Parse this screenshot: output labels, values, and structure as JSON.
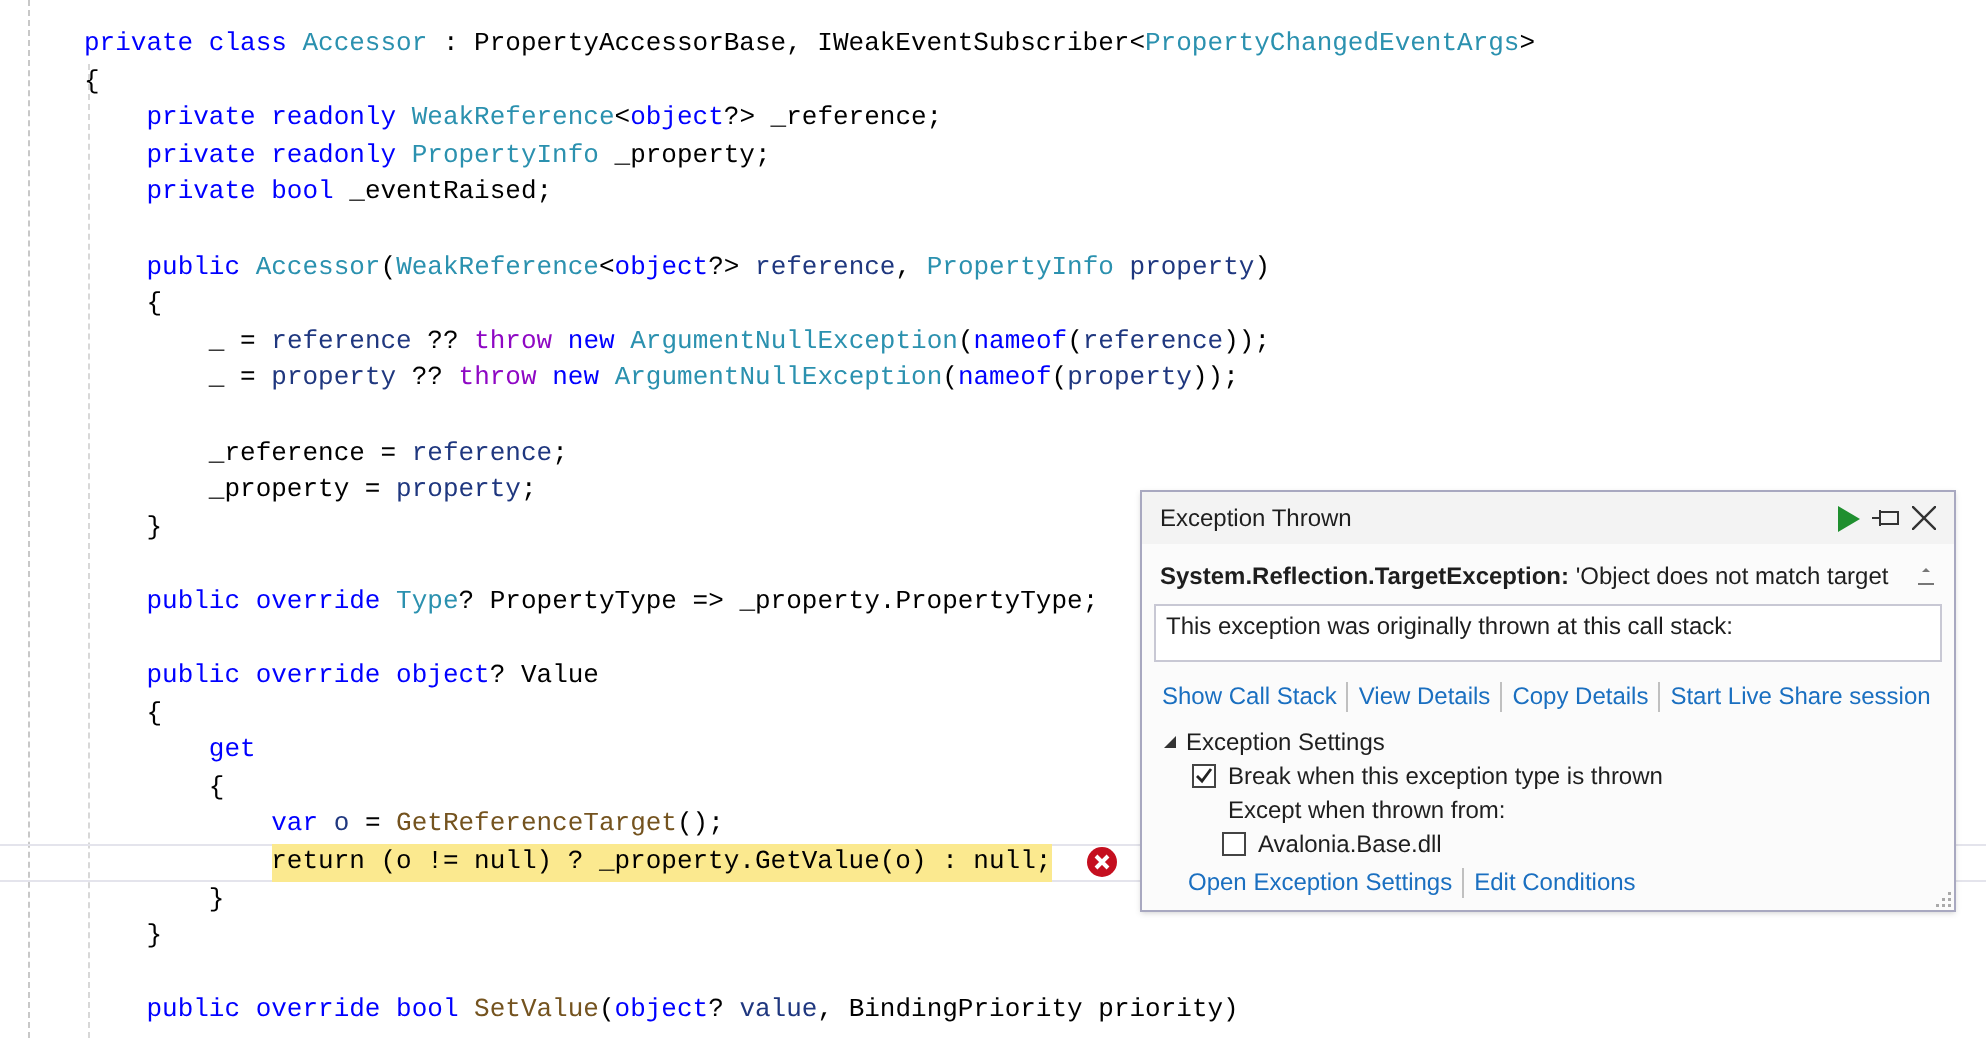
{
  "editor": {
    "lines": [
      {
        "kind": "code",
        "current": false,
        "tokens": [
          {
            "text": "private class ",
            "kind": "keyword"
          },
          {
            "text": "Accessor",
            "kind": "type"
          },
          {
            "text": " : PropertyAccessorBase, IWeakEventSubscriber<",
            "kind": "plain"
          },
          {
            "text": "PropertyChangedEventArgs",
            "kind": "type"
          },
          {
            "text": ">",
            "kind": "plain"
          }
        ]
      },
      {
        "kind": "code",
        "current": false,
        "tokens": [
          {
            "text": "{",
            "kind": "plain"
          }
        ]
      },
      {
        "kind": "code",
        "current": false,
        "tokens": [
          {
            "text": "    private readonly ",
            "kind": "keyword"
          },
          {
            "text": "WeakReference",
            "kind": "type"
          },
          {
            "text": "<",
            "kind": "plain"
          },
          {
            "text": "object",
            "kind": "keyword"
          },
          {
            "text": "?> _reference;",
            "kind": "plain"
          }
        ]
      },
      {
        "kind": "code",
        "current": false,
        "tokens": [
          {
            "text": "    private readonly ",
            "kind": "keyword"
          },
          {
            "text": "PropertyInfo",
            "kind": "type"
          },
          {
            "text": " _property;",
            "kind": "plain"
          }
        ]
      },
      {
        "kind": "code",
        "current": false,
        "tokens": [
          {
            "text": "    private bool",
            "kind": "keyword"
          },
          {
            "text": " _eventRaised;",
            "kind": "plain"
          }
        ]
      },
      {
        "kind": "blank"
      },
      {
        "kind": "code",
        "current": false,
        "tokens": [
          {
            "text": "    public ",
            "kind": "keyword"
          },
          {
            "text": "Accessor",
            "kind": "type"
          },
          {
            "text": "(",
            "kind": "plain"
          },
          {
            "text": "WeakReference",
            "kind": "type"
          },
          {
            "text": "<",
            "kind": "plain"
          },
          {
            "text": "object",
            "kind": "keyword"
          },
          {
            "text": "?> ",
            "kind": "plain"
          },
          {
            "text": "reference",
            "kind": "variable"
          },
          {
            "text": ", ",
            "kind": "plain"
          },
          {
            "text": "PropertyInfo",
            "kind": "type"
          },
          {
            "text": " property",
            "kind": "variable"
          },
          {
            "text": ")",
            "kind": "plain"
          }
        ]
      },
      {
        "kind": "code",
        "current": false,
        "tokens": [
          {
            "text": "    {",
            "kind": "plain"
          }
        ]
      },
      {
        "kind": "code",
        "current": false,
        "tokens": [
          {
            "text": "        _ = ",
            "kind": "plain"
          },
          {
            "text": "reference",
            "kind": "variable"
          },
          {
            "text": " ?? ",
            "kind": "plain"
          },
          {
            "text": "throw",
            "kind": "control"
          },
          {
            "text": " new ",
            "kind": "keyword"
          },
          {
            "text": "ArgumentNullException",
            "kind": "type"
          },
          {
            "text": "(",
            "kind": "plain"
          },
          {
            "text": "nameof",
            "kind": "keyword"
          },
          {
            "text": "(",
            "kind": "plain"
          },
          {
            "text": "reference",
            "kind": "variable"
          },
          {
            "text": "));",
            "kind": "plain"
          }
        ]
      },
      {
        "kind": "code",
        "current": false,
        "tokens": [
          {
            "text": "        _ = ",
            "kind": "plain"
          },
          {
            "text": "property",
            "kind": "variable"
          },
          {
            "text": " ?? ",
            "kind": "plain"
          },
          {
            "text": "throw",
            "kind": "control"
          },
          {
            "text": " new ",
            "kind": "keyword"
          },
          {
            "text": "ArgumentNullException",
            "kind": "type"
          },
          {
            "text": "(",
            "kind": "plain"
          },
          {
            "text": "nameof",
            "kind": "keyword"
          },
          {
            "text": "(",
            "kind": "plain"
          },
          {
            "text": "property",
            "kind": "variable"
          },
          {
            "text": "));",
            "kind": "plain"
          }
        ]
      },
      {
        "kind": "blank"
      },
      {
        "kind": "code",
        "current": false,
        "tokens": [
          {
            "text": "        _reference = ",
            "kind": "plain"
          },
          {
            "text": "reference",
            "kind": "variable"
          },
          {
            "text": ";",
            "kind": "plain"
          }
        ]
      },
      {
        "kind": "code",
        "current": false,
        "tokens": [
          {
            "text": "        _property = ",
            "kind": "plain"
          },
          {
            "text": "property",
            "kind": "variable"
          },
          {
            "text": ";",
            "kind": "plain"
          }
        ]
      },
      {
        "kind": "code",
        "current": false,
        "tokens": [
          {
            "text": "    }",
            "kind": "plain"
          }
        ]
      },
      {
        "kind": "blank"
      },
      {
        "kind": "code",
        "current": false,
        "tokens": [
          {
            "text": "    public override ",
            "kind": "keyword"
          },
          {
            "text": "Type",
            "kind": "type"
          },
          {
            "text": "? PropertyType => _property.PropertyType;",
            "kind": "plain"
          }
        ]
      },
      {
        "kind": "blank"
      },
      {
        "kind": "code",
        "current": false,
        "tokens": [
          {
            "text": "    public override object",
            "kind": "keyword"
          },
          {
            "text": "? Value",
            "kind": "plain"
          }
        ]
      },
      {
        "kind": "code",
        "current": false,
        "tokens": [
          {
            "text": "    {",
            "kind": "plain"
          }
        ]
      },
      {
        "kind": "code",
        "current": false,
        "tokens": [
          {
            "text": "        get",
            "kind": "keyword"
          }
        ]
      },
      {
        "kind": "code",
        "current": false,
        "tokens": [
          {
            "text": "        {",
            "kind": "plain"
          }
        ]
      },
      {
        "kind": "code",
        "current": false,
        "tokens": [
          {
            "text": "            var",
            "kind": "keyword"
          },
          {
            "text": " o",
            "kind": "variable"
          },
          {
            "text": " = ",
            "kind": "plain"
          },
          {
            "text": "GetReferenceTarget",
            "kind": "method"
          },
          {
            "text": "();",
            "kind": "plain"
          }
        ]
      },
      {
        "kind": "code",
        "current": true,
        "tokens": [
          {
            "text": "            return (o != null) ? _property.GetValue(o) : null;",
            "kind": "plain"
          }
        ]
      },
      {
        "kind": "code",
        "current": false,
        "tokens": [
          {
            "text": "        }",
            "kind": "plain"
          }
        ]
      },
      {
        "kind": "code",
        "current": false,
        "tokens": [
          {
            "text": "    }",
            "kind": "plain"
          }
        ]
      },
      {
        "kind": "blank"
      },
      {
        "kind": "code",
        "current": false,
        "tokens": [
          {
            "text": "    public override bool",
            "kind": "keyword"
          },
          {
            "text": " SetValue",
            "kind": "method"
          },
          {
            "text": "(",
            "kind": "plain"
          },
          {
            "text": "object",
            "kind": "keyword"
          },
          {
            "text": "? ",
            "kind": "plain"
          },
          {
            "text": "value",
            "kind": "variable"
          },
          {
            "text": ", BindingPriority priority)",
            "kind": "plain"
          }
        ]
      }
    ]
  },
  "exception_popup": {
    "title": "Exception Thrown",
    "message": "**System.Reflection.TargetException:** 'Object does not match target",
    "call_stack_note": "This exception was originally thrown at this call stack:",
    "links": [
      "Show Call Stack",
      "View Details",
      "Copy Details",
      "Start Live Share session"
    ],
    "settings": {
      "label": "Exception Settings",
      "expanded": true,
      "items": [
        {
          "kind": "checkbox",
          "label": "Break when this exception type is thrown",
          "checked": true
        },
        {
          "kind": "label",
          "label": "Except when thrown from:"
        },
        {
          "kind": "checkbox",
          "label": "Avalonia.Base.dll",
          "checked": false
        }
      ]
    },
    "bottom_links": [
      "Open Exception Settings",
      "Edit Conditions"
    ]
  }
}
